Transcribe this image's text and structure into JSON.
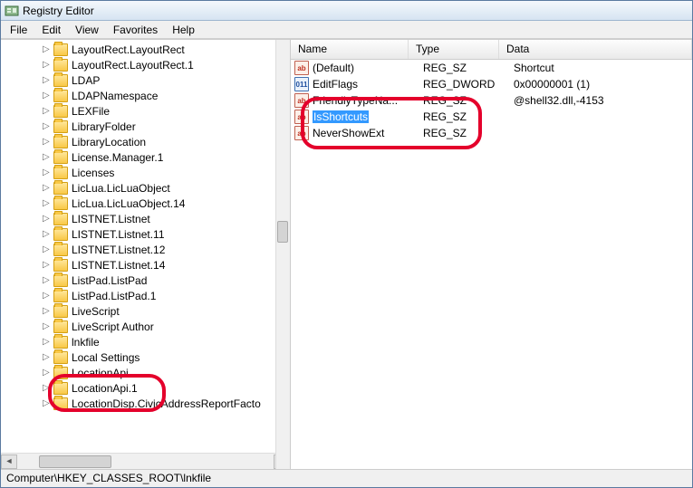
{
  "window": {
    "title": "Registry Editor"
  },
  "menu": {
    "file": "File",
    "edit": "Edit",
    "view": "View",
    "favorites": "Favorites",
    "help": "Help"
  },
  "tree": {
    "items": [
      {
        "label": "LayoutRect.LayoutRect"
      },
      {
        "label": "LayoutRect.LayoutRect.1"
      },
      {
        "label": "LDAP"
      },
      {
        "label": "LDAPNamespace"
      },
      {
        "label": "LEXFile"
      },
      {
        "label": "LibraryFolder"
      },
      {
        "label": "LibraryLocation"
      },
      {
        "label": "License.Manager.1"
      },
      {
        "label": "Licenses"
      },
      {
        "label": "LicLua.LicLuaObject"
      },
      {
        "label": "LicLua.LicLuaObject.14"
      },
      {
        "label": "LISTNET.Listnet"
      },
      {
        "label": "LISTNET.Listnet.11"
      },
      {
        "label": "LISTNET.Listnet.12"
      },
      {
        "label": "LISTNET.Listnet.14"
      },
      {
        "label": "ListPad.ListPad"
      },
      {
        "label": "ListPad.ListPad.1"
      },
      {
        "label": "LiveScript"
      },
      {
        "label": "LiveScript Author"
      },
      {
        "label": "lnkfile"
      },
      {
        "label": "Local Settings"
      },
      {
        "label": "LocationApi"
      },
      {
        "label": "LocationApi.1"
      },
      {
        "label": "LocationDisp.CivicAddressReportFacto"
      }
    ]
  },
  "list": {
    "headers": {
      "name": "Name",
      "type": "Type",
      "data": "Data"
    },
    "rows": [
      {
        "icon": "str",
        "name": "(Default)",
        "type": "REG_SZ",
        "data": "Shortcut"
      },
      {
        "icon": "bin",
        "name": "EditFlags",
        "type": "REG_DWORD",
        "data": "0x00000001 (1)"
      },
      {
        "icon": "str",
        "name": "FriendlyTypeNa...",
        "type": "REG_SZ",
        "data": "@shell32.dll,-4153"
      },
      {
        "icon": "str",
        "name": "IsShortcuts",
        "type": "REG_SZ",
        "data": "",
        "selected": true
      },
      {
        "icon": "str",
        "name": "NeverShowExt",
        "type": "REG_SZ",
        "data": ""
      }
    ]
  },
  "status": {
    "path": "Computer\\HKEY_CLASSES_ROOT\\lnkfile"
  }
}
